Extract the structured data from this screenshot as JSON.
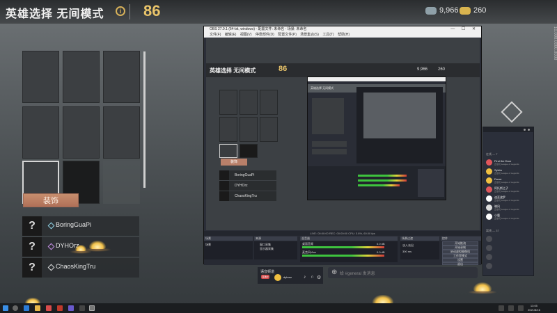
{
  "game": {
    "mode_title": "英雄选择 无间模式",
    "timer_icon": "timer-icon",
    "timer_value": "86",
    "blue_essence": "9,966",
    "riot_points": "260",
    "skins_button": "装饰",
    "side_strip_text": "10.000.0000.0000",
    "players": [
      {
        "name": "BoringGuaPi",
        "avatar": "?"
      },
      {
        "name": "DYHOrz",
        "avatar": "?"
      },
      {
        "name": "ChaosKingTru",
        "avatar": "?"
      }
    ]
  },
  "obs": {
    "window_title": "OBS 27.0.1 (64-bit, windows) - 配置文件: 未命名 - 场景: 未命名",
    "menu": "文件(F) 编辑(E) 视图(V) 停靠部件(D) 配置文件(P) 场景集合(S) 工具(T) 帮助(H)",
    "preview": {
      "title": "英雄选择 无间模式",
      "timer": "86",
      "blue_essence": "9,966",
      "riot_points": "260",
      "skins_button": "装饰",
      "players": [
        "BoringGuaPi",
        "DYHOrz",
        "ChaosKingTru"
      ]
    },
    "status_bar": "LIVE: 00:00:00  REC: 00:00:00  CPU: 3.8%, 60.00 fps",
    "docks": {
      "scenes_header": "场景",
      "scenes": [
        "场景"
      ],
      "sources_header": "来源",
      "sources": [
        "窗口采集",
        "显示器采集"
      ],
      "mixer_header": "混音器",
      "mixer_tracks": [
        {
          "name": "桌面音频",
          "db": "0.0 dB"
        },
        {
          "name": "麦克风/Aux",
          "db": "0.0 dB"
        }
      ],
      "transitions_header": "场景过渡",
      "transition_value": "淡入淡出",
      "duration_value": "300 ms",
      "controls_header": "控件",
      "controls": [
        "开始推流",
        "开始录制",
        "启动虚拟摄像机",
        "工作室模式",
        "设置",
        "退出"
      ]
    }
  },
  "chat": {
    "online_header": "在线 — 7",
    "members": [
      {
        "name": "Find the Door",
        "status": "正在玩 League of Legends",
        "color": "#e0565b"
      },
      {
        "name": "Sylvia",
        "status": "正在玩 League of Legends",
        "color": "#f0c040"
      },
      {
        "name": "Dover",
        "status": "正在玩 League of Legends",
        "color": "#f0c040"
      },
      {
        "name": "阿托斯之子",
        "status": "正在玩 League of Legends",
        "color": "#e0565b"
      },
      {
        "name": "迪亚波罗",
        "status": "正在玩 League of Legends",
        "color": "#ffffff"
      },
      {
        "name": "晓风",
        "status": "正在玩 League of Legends",
        "color": "#dddddd"
      },
      {
        "name": "小鹿",
        "status": "正在玩 League of Legends",
        "color": "#ffffff"
      }
    ],
    "offline_header": "离线 — 37"
  },
  "voice": {
    "channel": "语音频道",
    "live_badge": "直播中",
    "user": "dyhorz"
  },
  "message_input": {
    "placeholder": "给 #general 发消息"
  },
  "taskbar": {
    "time": "13:05",
    "date": "2021/8/16"
  }
}
